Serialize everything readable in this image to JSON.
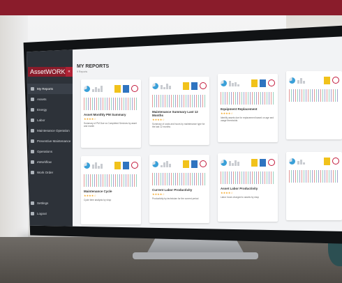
{
  "app": {
    "brand": "AssetWORKS",
    "collapse_label": "«"
  },
  "sidebar": {
    "items": [
      {
        "label": "My Reports",
        "icon": "user-icon"
      },
      {
        "label": "Assets",
        "icon": "truck-icon"
      },
      {
        "label": "Energy",
        "icon": "bolt-icon"
      },
      {
        "label": "Labor",
        "icon": "users-icon"
      },
      {
        "label": "Maintenance Operation",
        "icon": "wrench-icon"
      },
      {
        "label": "Preventive Maintenance",
        "icon": "calendar-icon"
      },
      {
        "label": "Operations",
        "icon": "gear-icon"
      },
      {
        "label": "eWorkflow",
        "icon": "share-icon"
      },
      {
        "label": "Work Order",
        "icon": "clipboard-icon"
      }
    ],
    "bottom_items": [
      {
        "label": "Settings",
        "icon": "gear-icon"
      },
      {
        "label": "Logout",
        "icon": "logout-icon"
      }
    ]
  },
  "main": {
    "title": "MY REPORTS",
    "subtitle": "9 Reports"
  },
  "cards": [
    {
      "title": "Asset Monthly PM Summary",
      "stars": "★★★★☆",
      "desc": "Summary of PM Due vs Completed Services by asset and month"
    },
    {
      "title": "Maintenance Summary Last 12 Months",
      "stars": "★★★★☆",
      "desc": "Summary of costs and hours by maintenance type for the last 12 months"
    },
    {
      "title": "Equipment Replacement",
      "stars": "★★★★☆",
      "desc": "Identify assets due for replacement based on age and usage thresholds"
    },
    {
      "title": "Maintenance Cycle",
      "stars": "★★★★☆",
      "desc": "Cycle time analysis by shop"
    },
    {
      "title": "Current Labor Productivity",
      "stars": "★★★★☆",
      "desc": "Productivity by technician for the current period"
    },
    {
      "title": "Asset Labor Productivity",
      "stars": "★★★★☆",
      "desc": "Labor hours charged to assets by shop"
    }
  ]
}
